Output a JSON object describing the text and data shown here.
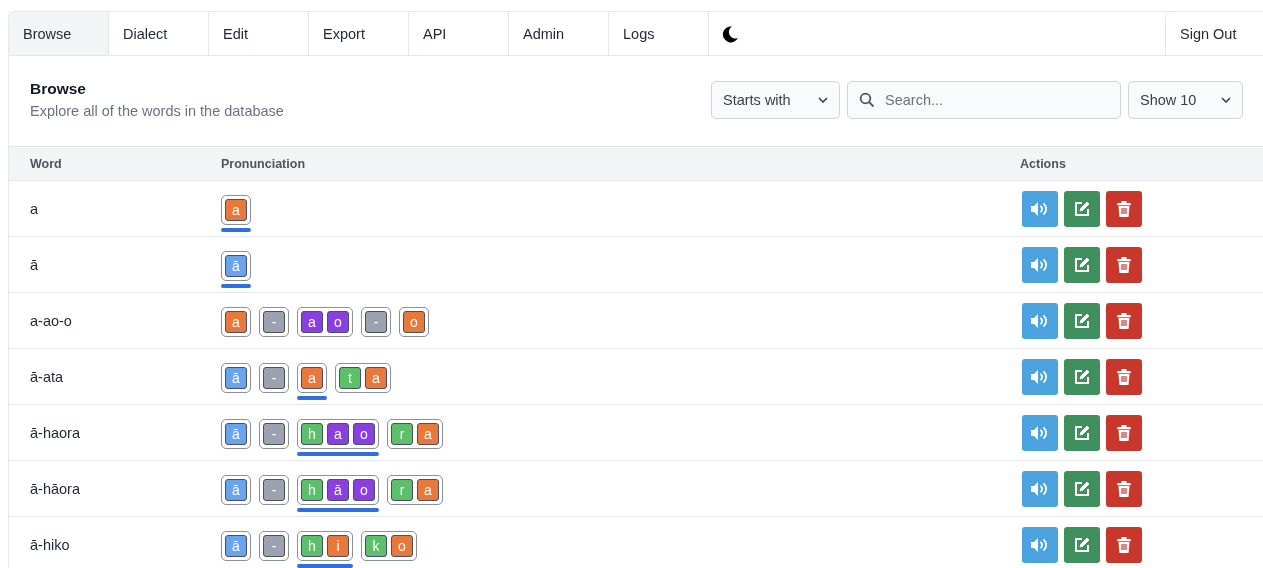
{
  "tabs": [
    {
      "label": "Browse",
      "selected": true
    },
    {
      "label": "Dialect",
      "selected": false
    },
    {
      "label": "Edit",
      "selected": false
    },
    {
      "label": "Export",
      "selected": false
    },
    {
      "label": "API",
      "selected": false
    },
    {
      "label": "Admin",
      "selected": false
    },
    {
      "label": "Logs",
      "selected": false
    }
  ],
  "sign_out": "Sign Out",
  "header": {
    "title": "Browse",
    "subtitle": "Explore all of the words in the database"
  },
  "filters": {
    "match_mode": "Starts with",
    "search": {
      "placeholder": "Search..."
    },
    "page_size": "Show 10"
  },
  "table": {
    "columns": [
      "Word",
      "Pronunciation",
      "Actions"
    ],
    "rows": [
      {
        "word": "a",
        "groups": [
          {
            "stressed": true,
            "letters": [
              {
                "char": "a",
                "color": "#e8793a"
              }
            ]
          }
        ]
      },
      {
        "word": "ā",
        "groups": [
          {
            "stressed": true,
            "letters": [
              {
                "char": "ā",
                "color": "#6aa4ef"
              }
            ]
          }
        ]
      },
      {
        "word": "a-ao-o",
        "groups": [
          {
            "stressed": false,
            "letters": [
              {
                "char": "a",
                "color": "#e8793a"
              }
            ]
          },
          {
            "stressed": false,
            "letters": [
              {
                "char": "-",
                "color": "#9ca3af"
              }
            ]
          },
          {
            "stressed": false,
            "letters": [
              {
                "char": "a",
                "color": "#8b3fe0"
              },
              {
                "char": "o",
                "color": "#8b3fe0"
              }
            ]
          },
          {
            "stressed": false,
            "letters": [
              {
                "char": "-",
                "color": "#9ca3af"
              }
            ]
          },
          {
            "stressed": false,
            "letters": [
              {
                "char": "o",
                "color": "#e8793a"
              }
            ]
          }
        ]
      },
      {
        "word": "ā-ata",
        "groups": [
          {
            "stressed": false,
            "letters": [
              {
                "char": "ā",
                "color": "#6aa4ef"
              }
            ]
          },
          {
            "stressed": false,
            "letters": [
              {
                "char": "-",
                "color": "#9ca3af"
              }
            ]
          },
          {
            "stressed": true,
            "letters": [
              {
                "char": "a",
                "color": "#e8793a"
              }
            ]
          },
          {
            "stressed": false,
            "letters": [
              {
                "char": "t",
                "color": "#5cbf6a"
              },
              {
                "char": "a",
                "color": "#e8793a"
              }
            ]
          }
        ]
      },
      {
        "word": "ā-haora",
        "groups": [
          {
            "stressed": false,
            "letters": [
              {
                "char": "ā",
                "color": "#6aa4ef"
              }
            ]
          },
          {
            "stressed": false,
            "letters": [
              {
                "char": "-",
                "color": "#9ca3af"
              }
            ]
          },
          {
            "stressed": true,
            "letters": [
              {
                "char": "h",
                "color": "#5cbf6a"
              },
              {
                "char": "a",
                "color": "#8b3fe0"
              },
              {
                "char": "o",
                "color": "#8b3fe0"
              }
            ]
          },
          {
            "stressed": false,
            "letters": [
              {
                "char": "r",
                "color": "#5cbf6a"
              },
              {
                "char": "a",
                "color": "#e8793a"
              }
            ]
          }
        ]
      },
      {
        "word": "ā-hāora",
        "groups": [
          {
            "stressed": false,
            "letters": [
              {
                "char": "ā",
                "color": "#6aa4ef"
              }
            ]
          },
          {
            "stressed": false,
            "letters": [
              {
                "char": "-",
                "color": "#9ca3af"
              }
            ]
          },
          {
            "stressed": true,
            "letters": [
              {
                "char": "h",
                "color": "#5cbf6a"
              },
              {
                "char": "ā",
                "color": "#8b3fe0"
              },
              {
                "char": "o",
                "color": "#8b3fe0"
              }
            ]
          },
          {
            "stressed": false,
            "letters": [
              {
                "char": "r",
                "color": "#5cbf6a"
              },
              {
                "char": "a",
                "color": "#e8793a"
              }
            ]
          }
        ]
      },
      {
        "word": "ā-hiko",
        "groups": [
          {
            "stressed": false,
            "letters": [
              {
                "char": "ā",
                "color": "#6aa4ef"
              }
            ]
          },
          {
            "stressed": false,
            "letters": [
              {
                "char": "-",
                "color": "#9ca3af"
              }
            ]
          },
          {
            "stressed": true,
            "letters": [
              {
                "char": "h",
                "color": "#5cbf6a"
              },
              {
                "char": "i",
                "color": "#e8793a"
              }
            ]
          },
          {
            "stressed": false,
            "letters": [
              {
                "char": "k",
                "color": "#5cbf6a"
              },
              {
                "char": "o",
                "color": "#e8793a"
              }
            ]
          }
        ]
      }
    ]
  }
}
